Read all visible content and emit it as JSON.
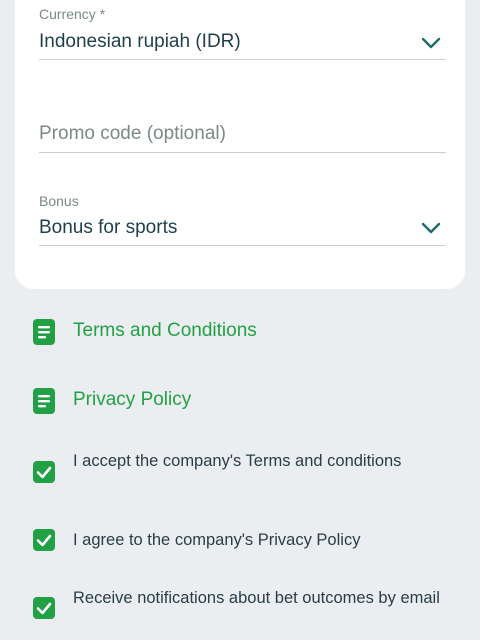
{
  "form": {
    "currency": {
      "label": "Currency *",
      "value": "Indonesian rupiah (IDR)"
    },
    "promo": {
      "placeholder": "Promo code (optional)"
    },
    "bonus": {
      "label": "Bonus",
      "value": "Bonus for sports"
    }
  },
  "links": [
    {
      "label": "Terms and Conditions",
      "icon": "document-icon"
    },
    {
      "label": "Privacy Policy",
      "icon": "document-icon"
    }
  ],
  "checkboxes": [
    {
      "label": "I accept the company's Terms and conditions",
      "checked": true
    },
    {
      "label": "I agree to the company's Privacy Policy",
      "checked": true
    },
    {
      "label": "Receive notifications about bet outcomes by email",
      "checked": true
    }
  ],
  "colors": {
    "accent": "#22a046",
    "background": "#ebeef0",
    "text": "#1f3f4d",
    "muted": "#7b8a85"
  }
}
